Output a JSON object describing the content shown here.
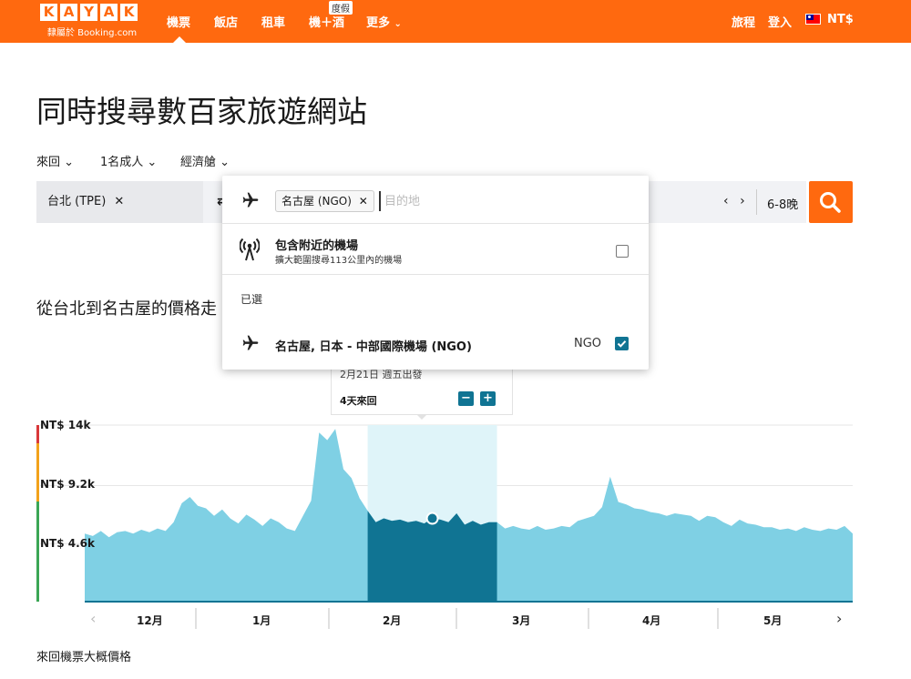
{
  "header": {
    "logo_letters": [
      "K",
      "A",
      "Y",
      "A",
      "K"
    ],
    "logo_sub": "隸屬於 Booking.com",
    "nav": [
      {
        "label": "機票",
        "active": true
      },
      {
        "label": "飯店"
      },
      {
        "label": "租車"
      },
      {
        "label": "機＋酒"
      },
      {
        "label": "更多"
      }
    ],
    "package_badge": "度假",
    "trips_label": "旅程",
    "login_label": "登入",
    "currency": "NT$"
  },
  "page": {
    "title": "同時搜尋數百家旅遊網站"
  },
  "options": {
    "trip_type": "來回",
    "travelers": "1名成人",
    "cabin": "經濟艙"
  },
  "search": {
    "origin": "台北 (TPE)",
    "nights": "6-8晚"
  },
  "dropdown": {
    "chip": "名古屋 (NGO)",
    "placeholder": "目的地",
    "nearby_title": "包含附近的機場",
    "nearby_sub": "擴大範圍搜尋113公里內的機場",
    "selected_label": "已選",
    "airport_name": "名古屋, 日本 - 中部國際機場 (NGO)",
    "airport_code": "NGO"
  },
  "price_section": {
    "title": "從台北到名古屋的價格走",
    "tooltip_date": "2月21日 週五出發",
    "tooltip_trip": "4天來回",
    "footnote": "來回機票大概價格"
  },
  "colors": {
    "brand": "#ff690f",
    "area": "#7fd0e4",
    "highlight_bg": "#dff4f9",
    "highlight_area": "#107493"
  },
  "chart_data": {
    "type": "area",
    "y_ticks": [
      "NT$ 14k",
      "NT$ 9.2k",
      "NT$ 4.6k"
    ],
    "y_tick_values": [
      14000,
      9200,
      4600
    ],
    "ylim": [
      0,
      14000
    ],
    "months": [
      "12月",
      "1月",
      "2月",
      "3月",
      "4月",
      "5月"
    ],
    "highlight_range": [
      35,
      51
    ],
    "selected_point": 43,
    "values": [
      5400,
      5200,
      5600,
      5100,
      5500,
      5600,
      5400,
      5700,
      5500,
      5800,
      5600,
      6300,
      7800,
      8300,
      7600,
      7400,
      6800,
      7300,
      6600,
      6200,
      6900,
      6500,
      6000,
      6600,
      6300,
      5800,
      5600,
      6800,
      8000,
      13400,
      12800,
      13700,
      10500,
      9800,
      8200,
      7200,
      6300,
      6600,
      6400,
      6500,
      6300,
      6400,
      6200,
      6600,
      6500,
      6300,
      7000,
      6100,
      6400,
      6100,
      6300,
      6300,
      5800,
      6000,
      5800,
      5700,
      6000,
      5700,
      5800,
      6000,
      5900,
      6400,
      6600,
      6800,
      7500,
      9900,
      7900,
      7700,
      7400,
      7300,
      7100,
      7000,
      6800,
      7000,
      6900,
      6800,
      6400,
      6800,
      6700,
      6300,
      6000,
      6500,
      6200,
      6100,
      5900,
      5900,
      5700,
      5800,
      5600,
      5900,
      5700,
      5600,
      5800,
      5700,
      6000,
      5400
    ]
  }
}
